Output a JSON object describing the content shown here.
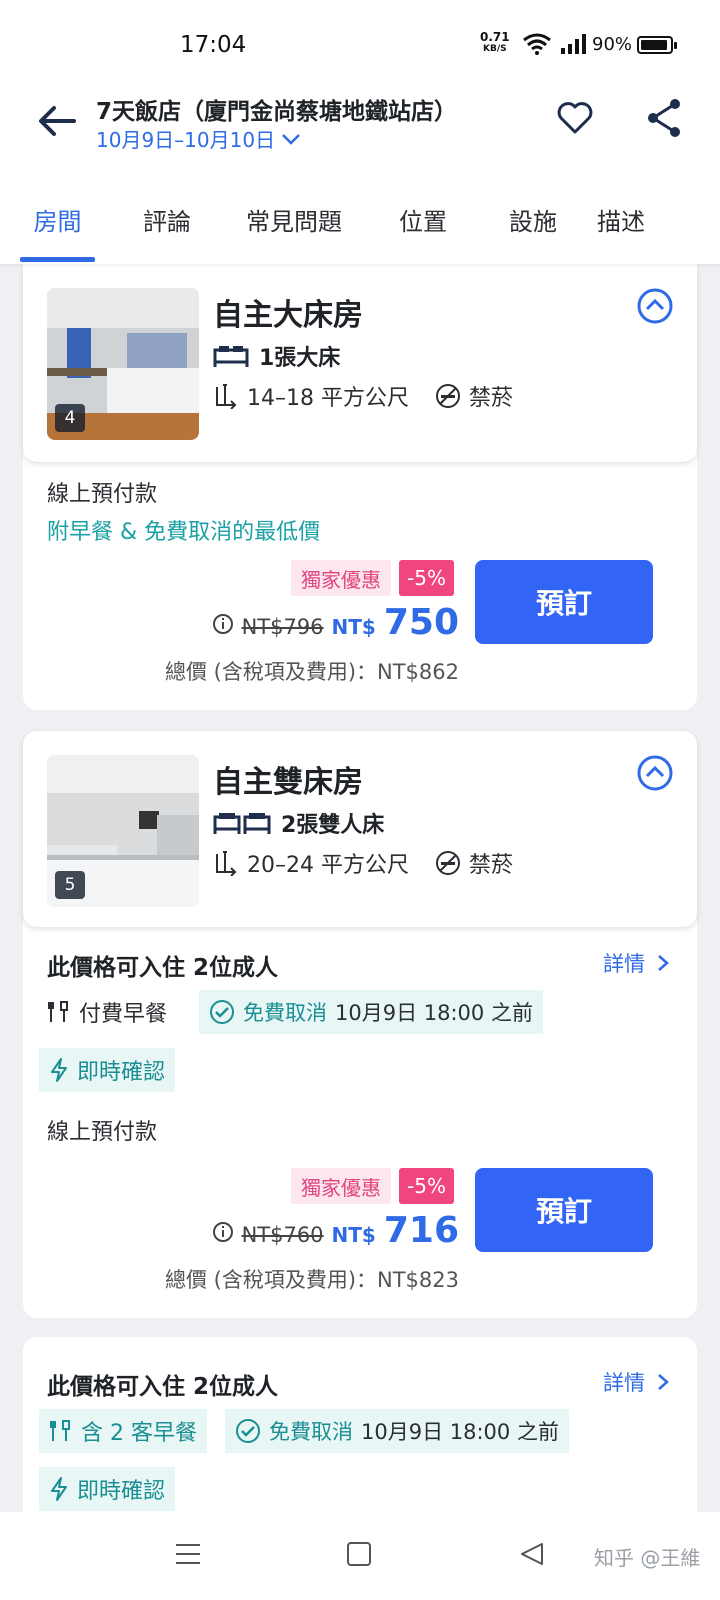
{
  "status": {
    "time": "17:04",
    "net_speed": "0.71",
    "net_unit": "KB/S",
    "battery": "90%"
  },
  "header": {
    "title": "7天飯店（廈門金尚蔡塘地鐵站店）",
    "dates": "10月9日–10月10日"
  },
  "tabs": [
    {
      "label": "房間",
      "active": true
    },
    {
      "label": "評論"
    },
    {
      "label": "常見問題"
    },
    {
      "label": "位置"
    },
    {
      "label": "設施"
    },
    {
      "label": "描述"
    }
  ],
  "rooms": [
    {
      "name": "自主大床房",
      "photo_count": "4",
      "beds": "1張大床",
      "size": "14–18 平方公尺",
      "smoking": "禁菸",
      "plans": [
        {
          "payment": "線上預付款",
          "highlight": "附早餐 & 免費取消的最低價",
          "promo_label": "獨家優惠",
          "promo_pct": "-5%",
          "old_price": "NT$796",
          "currency": "NT$",
          "price": "750",
          "total": "總價 (含稅項及費用)：NT$862",
          "book_label": "預訂"
        }
      ]
    },
    {
      "name": "自主雙床房",
      "photo_count": "5",
      "beds": "2張雙人床",
      "size": "20–24 平方公尺",
      "smoking": "禁菸",
      "plans": [
        {
          "occupancy_prefix": "此價格可入住 ",
          "occupancy_count": "2位成人",
          "details": "詳情",
          "meal": "付費早餐",
          "cancel_free": "免費取消",
          "cancel_when": "10月9日 18:00 之前",
          "instant": "即時確認",
          "payment": "線上預付款",
          "promo_label": "獨家優惠",
          "promo_pct": "-5%",
          "old_price": "NT$760",
          "currency": "NT$",
          "price": "716",
          "total": "總價 (含稅項及費用)：NT$823",
          "book_label": "預訂"
        },
        {
          "occupancy_prefix": "此價格可入住 ",
          "occupancy_count": "2位成人",
          "details": "詳情",
          "meal": "含 2 客早餐",
          "cancel_free": "免費取消",
          "cancel_when": "10月9日 18:00 之前",
          "instant": "即時確認"
        }
      ]
    }
  ],
  "watermark": "知乎 @王維",
  "colors": {
    "accent": "#2f6be6",
    "button": "#3264f5",
    "teal": "#1aa1a5",
    "promo": "#f0457f"
  }
}
